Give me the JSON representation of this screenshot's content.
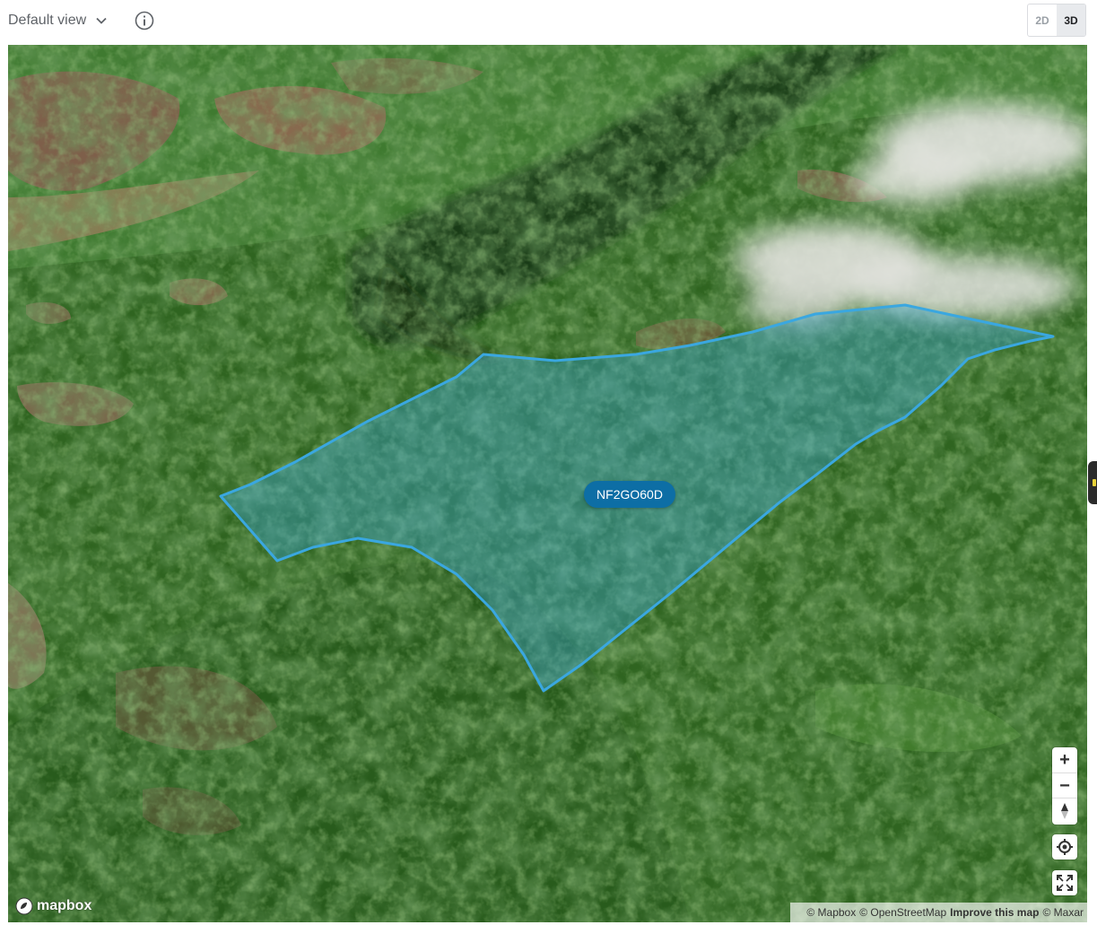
{
  "toolbar": {
    "view_select_label": "Default view",
    "info_icon": "info-icon",
    "mode_2d": "2D",
    "mode_3d": "3D",
    "active_mode": "3D"
  },
  "map": {
    "parcel_label": "NF2GO60D",
    "parcel_color": "#3aa7e0",
    "label_color": "#0d6ea5",
    "zoom_in": "+",
    "zoom_out": "−",
    "compass_icon": "compass-icon",
    "locate_icon": "locate-icon",
    "fullscreen_icon": "fullscreen-icon",
    "logo_text": "mapbox",
    "attribution": {
      "mapbox": "© Mapbox",
      "osm": "© OpenStreetMap",
      "improve": "Improve this map",
      "maxar": "© Maxar"
    }
  }
}
